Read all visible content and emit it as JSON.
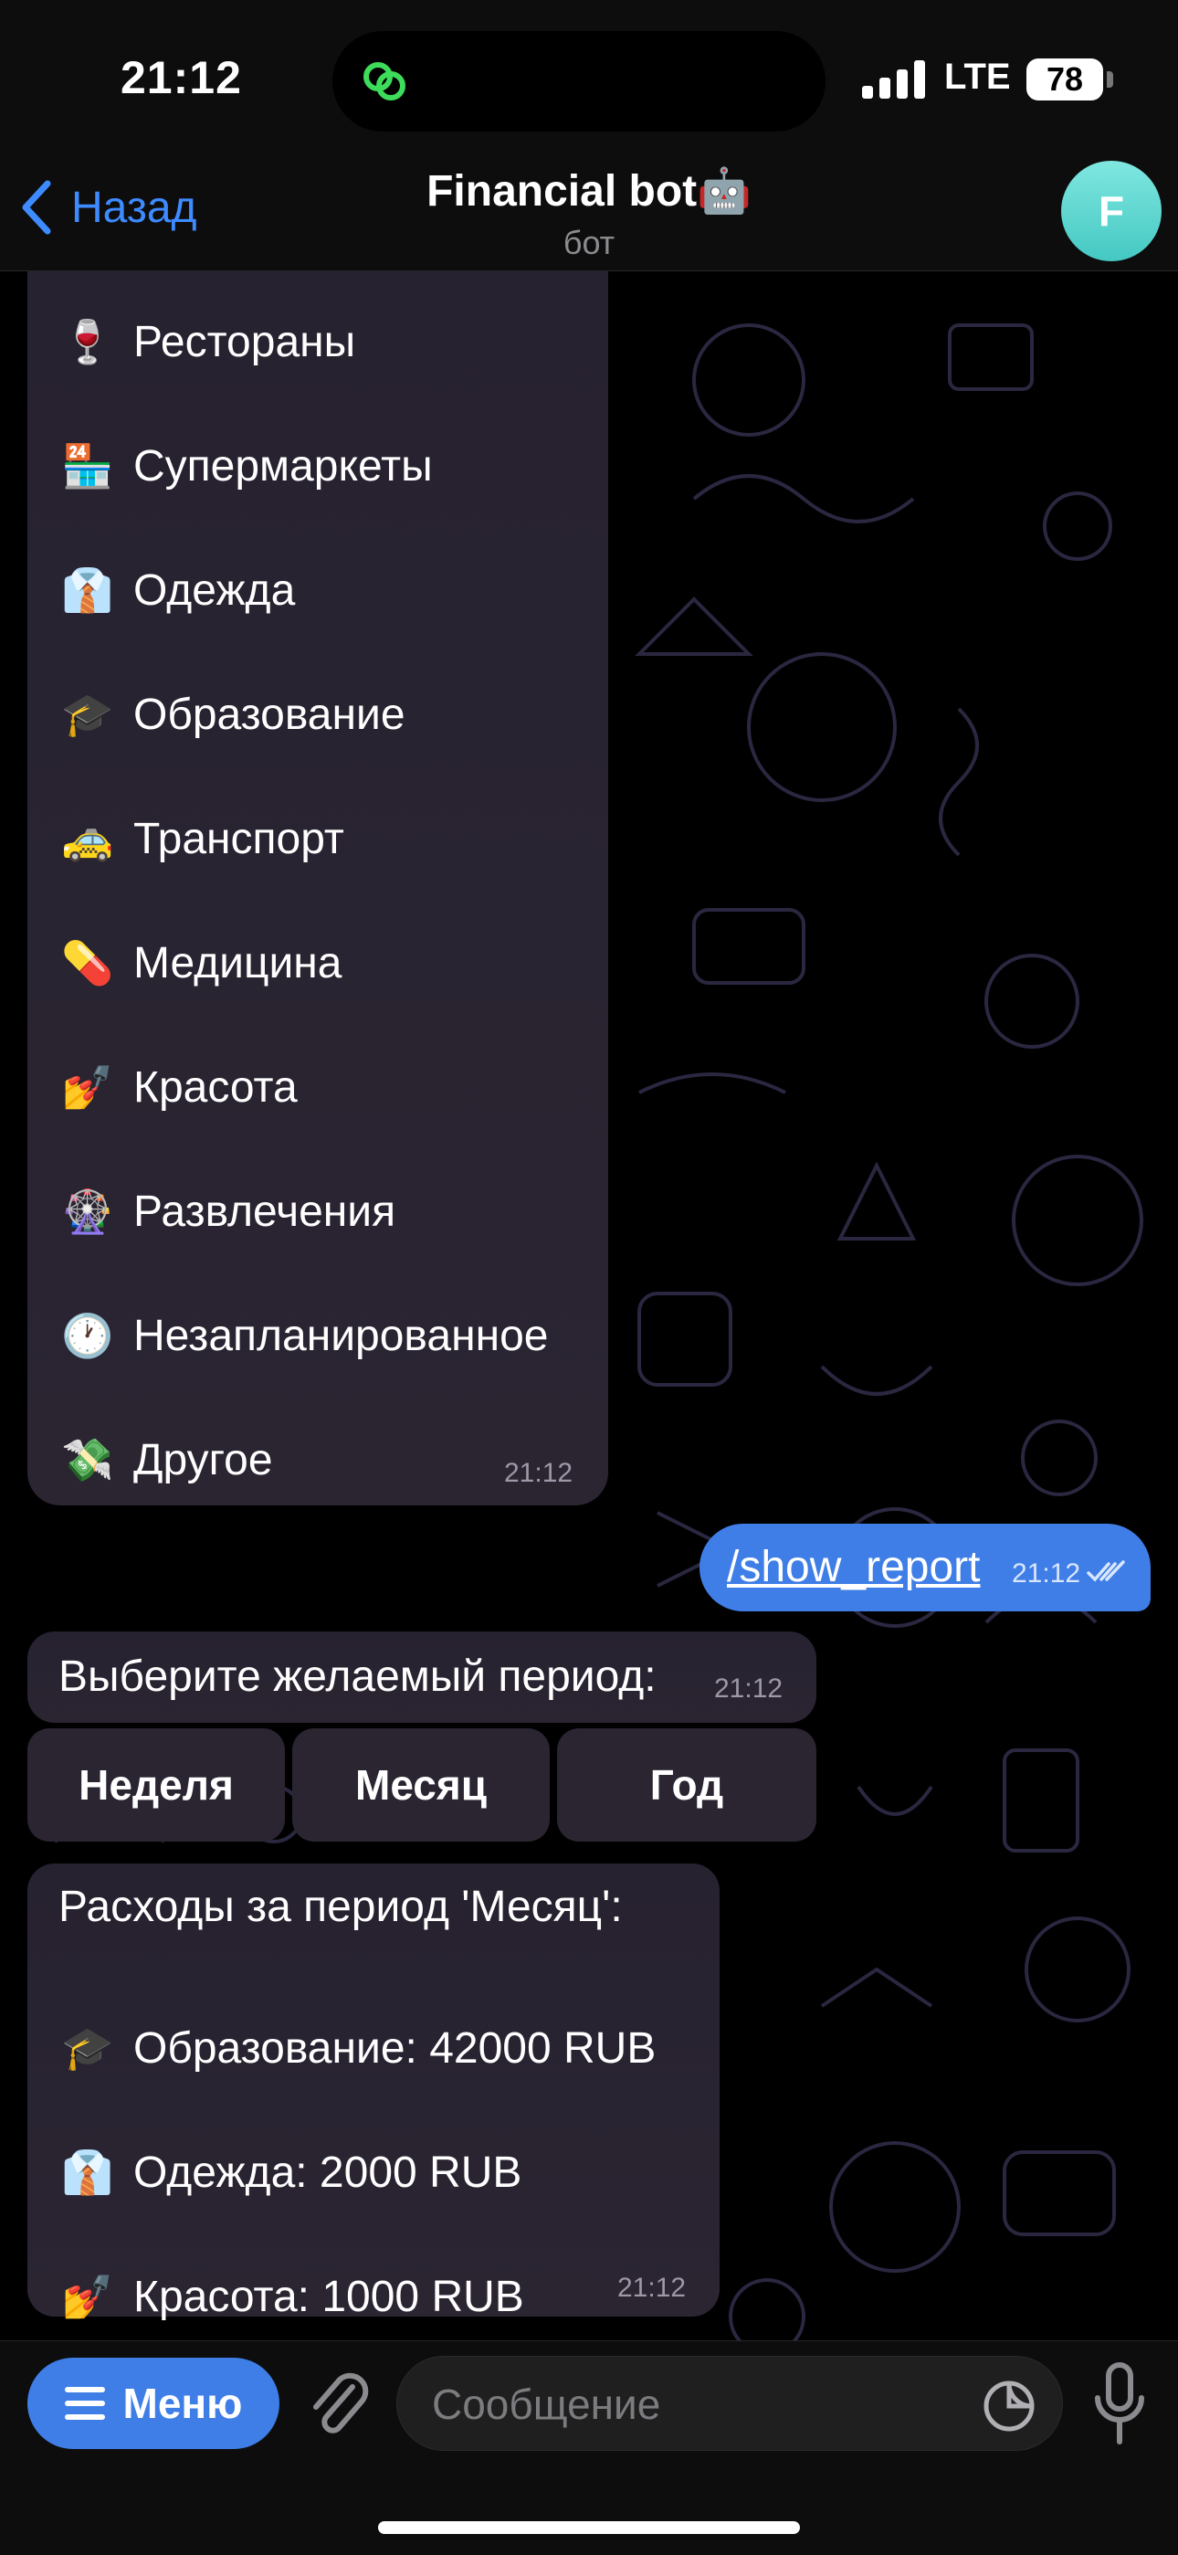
{
  "status": {
    "time": "21:12",
    "network": "LTE",
    "battery": "78"
  },
  "header": {
    "back_label": "Назад",
    "title": "Financial bot🤖",
    "subtitle": "бот",
    "avatar_letter": "F"
  },
  "categories_message": {
    "items": [
      {
        "emoji": "🍷",
        "label": "Рестораны"
      },
      {
        "emoji": "🏪",
        "label": "Супермаркеты"
      },
      {
        "emoji": "👔",
        "label": "Одежда"
      },
      {
        "emoji": "🎓",
        "label": "Образование"
      },
      {
        "emoji": "🚕",
        "label": "Транспорт"
      },
      {
        "emoji": "💊",
        "label": "Медицина"
      },
      {
        "emoji": "💅",
        "label": "Красота"
      },
      {
        "emoji": "🎡",
        "label": "Развлечения"
      },
      {
        "emoji": "🕐",
        "label": "Незапланированное"
      },
      {
        "emoji": "💸",
        "label": "Другое"
      }
    ],
    "time": "21:12"
  },
  "outgoing_message": {
    "text": "/show_report",
    "time": "21:12"
  },
  "period_prompt": {
    "text": "Выберите желаемый период:",
    "time": "21:12",
    "buttons": [
      "Неделя",
      "Месяц",
      "Год"
    ]
  },
  "report_message": {
    "header": "Расходы за период 'Месяц':",
    "lines": [
      {
        "emoji": "🎓",
        "text": "Образование: 42000 RUB"
      },
      {
        "emoji": "👔",
        "text": "Одежда: 2000 RUB"
      },
      {
        "emoji": "💅",
        "text": "Красота: 1000 RUB"
      }
    ],
    "time": "21:12"
  },
  "input_bar": {
    "menu_label": "Меню",
    "placeholder": "Сообщение"
  },
  "colors": {
    "accent": "#3e7ee6",
    "link": "#3e8bff",
    "bubble_in": "#2b2532",
    "avatar": "#5ed6d0"
  }
}
